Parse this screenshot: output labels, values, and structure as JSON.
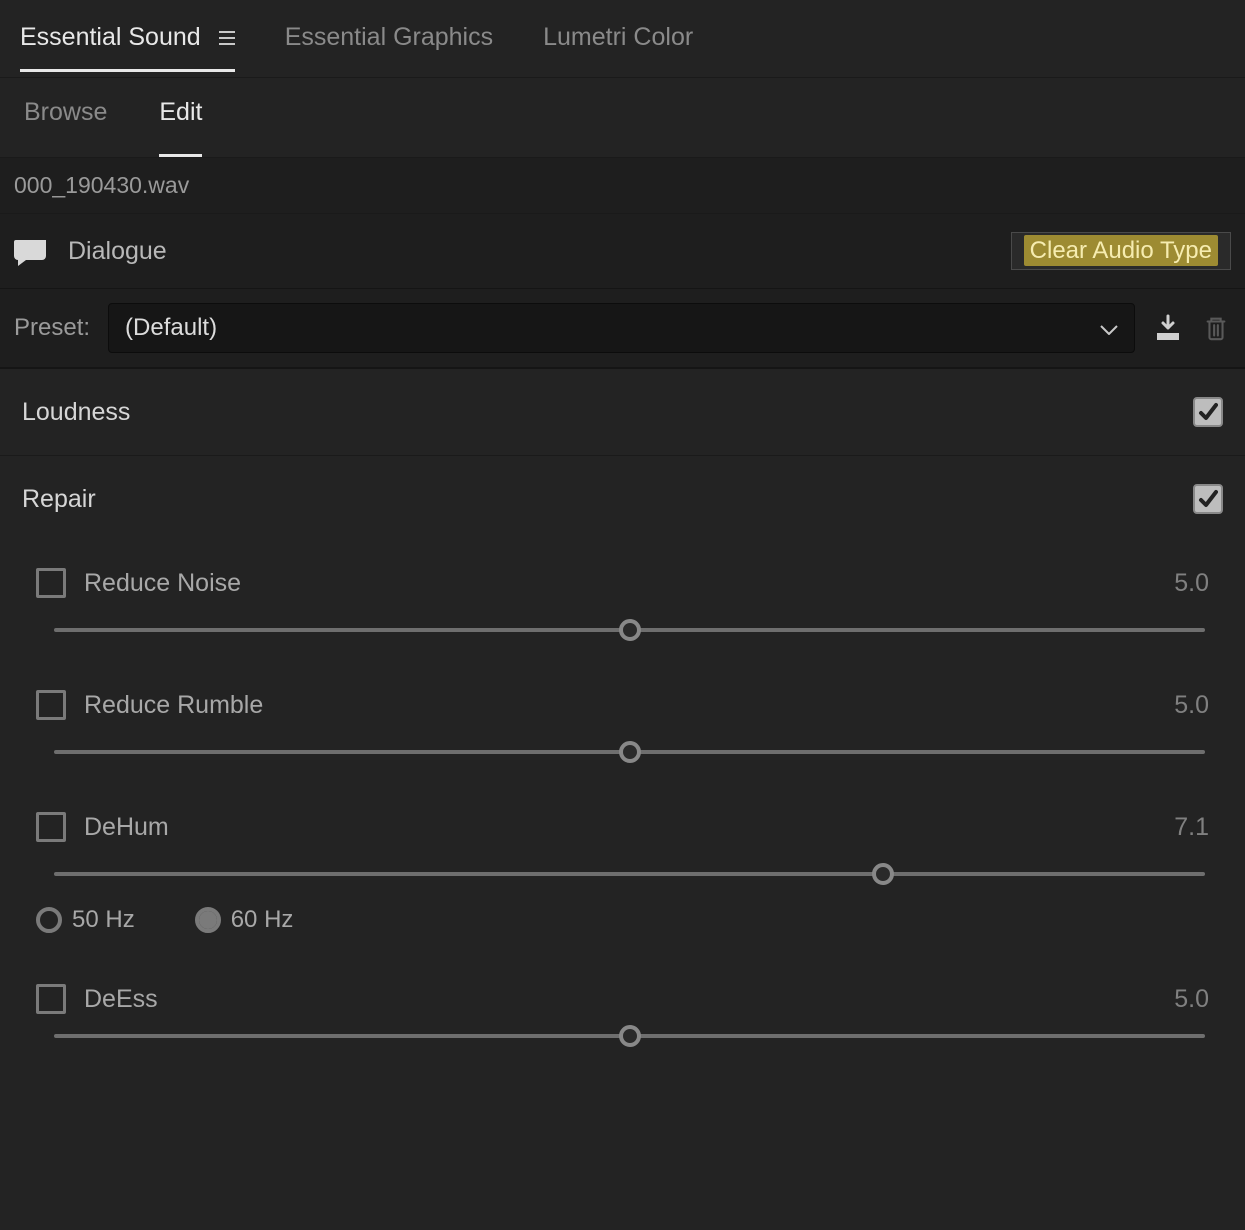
{
  "topTabs": {
    "essentialSound": "Essential Sound",
    "essentialGraphics": "Essential Graphics",
    "lumetriColor": "Lumetri Color"
  },
  "subTabs": {
    "browse": "Browse",
    "edit": "Edit"
  },
  "file": "000_190430.wav",
  "audioType": {
    "label": "Dialogue",
    "clear": "Clear Audio Type"
  },
  "preset": {
    "label": "Preset:",
    "value": "(Default)"
  },
  "sections": {
    "loudness": {
      "title": "Loudness",
      "enabled": true
    },
    "repair": {
      "title": "Repair",
      "enabled": true
    }
  },
  "repairParams": {
    "reduceNoise": {
      "label": "Reduce Noise",
      "value": "5.0",
      "pos": 50
    },
    "reduceRumble": {
      "label": "Reduce Rumble",
      "value": "5.0",
      "pos": 50
    },
    "deHum": {
      "label": "DeHum",
      "value": "7.1",
      "pos": 72
    },
    "deEss": {
      "label": "DeEss",
      "value": "5.0",
      "pos": 50
    }
  },
  "deHumFreq": {
    "opt50": "50 Hz",
    "opt60": "60 Hz",
    "selected": "60"
  }
}
